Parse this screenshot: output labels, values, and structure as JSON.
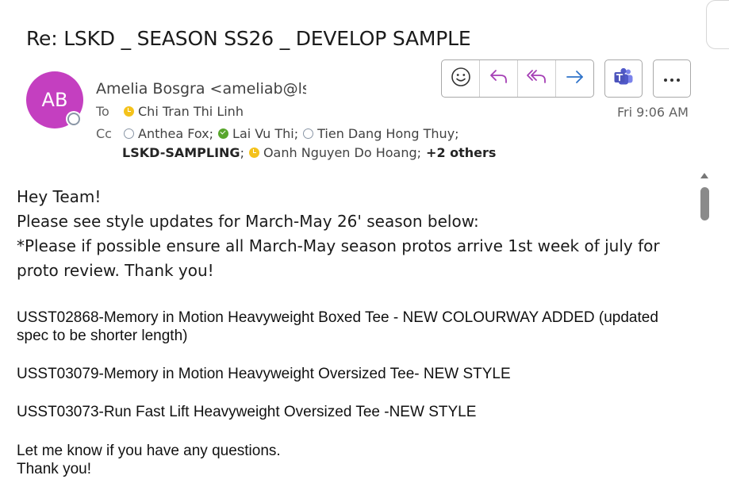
{
  "email": {
    "subject": "Re: LSKD _ SEASON SS26 _ DEVELOP SAMPLE",
    "sender": {
      "initials": "AB",
      "avatar_color": "#c43fc0",
      "display": "Amelia Bosgra <ameliab@lskd.co>"
    },
    "to_label": "To",
    "to": [
      {
        "name": "Chi Tran Thi Linh",
        "status": "away"
      }
    ],
    "cc_label": "Cc",
    "cc": [
      {
        "name": "Anthea Fox;",
        "status": "offline"
      },
      {
        "name": "Lai Vu Thi;",
        "status": "available"
      },
      {
        "name": "Tien Dang Hong Thuy;",
        "status": "offline"
      },
      {
        "name": "LSKD-SAMPLING",
        "status": "none"
      },
      {
        "name": "Oanh Nguyen Do Hoang;",
        "status": "away"
      }
    ],
    "cc_sep": ";",
    "others": "+2 others",
    "date": "Fri 9:06 AM"
  },
  "toolbar": {
    "emoji_icon": "smile-icon",
    "reply_icon": "reply-icon",
    "reply_all_icon": "reply-all-icon",
    "forward_icon": "forward-icon",
    "teams_icon": "teams-icon",
    "more_icon": "more-icon",
    "accent": "#a53fb5"
  },
  "body": {
    "greeting": "Hey Team!",
    "line1": "Please see style updates for March-May 26' season below:",
    "line2": "*Please if possible ensure all March-May season protos arrive 1st week of july for proto review. Thank you!",
    "item1": "USST02868-Memory in Motion Heavyweight Boxed Tee - NEW COLOURWAY ADDED (updated spec to be shorter length)",
    "item2": "USST03079-Memory in Motion Heavyweight Oversized Tee- NEW STYLE",
    "item3": "USST03073-Run Fast Lift Heavyweight Oversized Tee -NEW STYLE",
    "closing1": "Let me know if you have any questions.",
    "closing2": "Thank you!"
  }
}
